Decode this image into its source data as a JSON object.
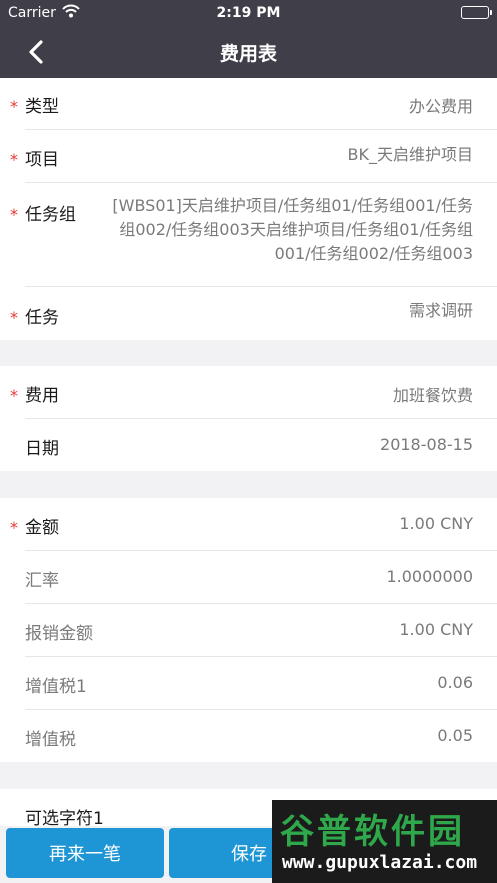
{
  "status": {
    "carrier": "Carrier",
    "time": "2:19 PM"
  },
  "nav": {
    "title": "费用表"
  },
  "section1": [
    {
      "label": "类型",
      "value": "办公费用",
      "required": true
    },
    {
      "label": "项目",
      "value": "BK_天启维护项目",
      "required": true
    },
    {
      "label": "任务组",
      "value": "[WBS01]天启维护项目/任务组01/任务组001/任务组002/任务组003天启维护项目/任务组01/任务组001/任务组002/任务组003",
      "required": true
    },
    {
      "label": "任务",
      "value": "需求调研",
      "required": true
    }
  ],
  "section2": [
    {
      "label": "费用",
      "value": "加班餐饮费",
      "required": true
    },
    {
      "label": "日期",
      "value": "2018-08-15",
      "required": false
    }
  ],
  "section3": [
    {
      "label": "金额",
      "value": "1.00  CNY",
      "required": true
    },
    {
      "label": "汇率",
      "value": "1.0000000",
      "required": false
    },
    {
      "label": "报销金额",
      "value": "1.00  CNY",
      "required": false
    },
    {
      "label": "增值税1",
      "value": "0.06",
      "required": false
    },
    {
      "label": "增值税",
      "value": "0.05",
      "required": false
    }
  ],
  "section4": [
    {
      "label": "可选字符1",
      "value": "",
      "required": false
    }
  ],
  "buttons": {
    "again": "再来一笔",
    "save": "保存"
  },
  "watermark": {
    "main": "谷普软件园",
    "url": "www.gupuxlazai.com"
  },
  "colors": {
    "nav_bg": "#403e48",
    "accent": "#1e96d6",
    "required": "#e53935"
  }
}
